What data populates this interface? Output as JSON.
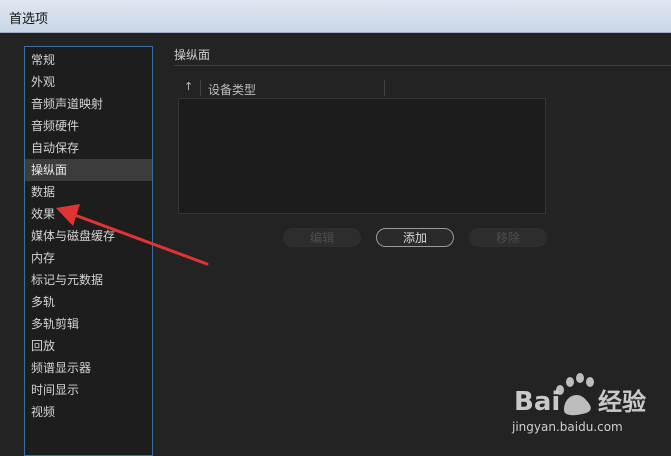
{
  "window": {
    "title": "首选项"
  },
  "sidebar": {
    "items": [
      {
        "label": "常规"
      },
      {
        "label": "外观"
      },
      {
        "label": "音频声道映射"
      },
      {
        "label": "音频硬件"
      },
      {
        "label": "自动保存"
      },
      {
        "label": "操纵面",
        "selected": true
      },
      {
        "label": "数据"
      },
      {
        "label": "效果"
      },
      {
        "label": "媒体与磁盘缓存"
      },
      {
        "label": "内存"
      },
      {
        "label": "标记与元数据"
      },
      {
        "label": "多轨"
      },
      {
        "label": "多轨剪辑"
      },
      {
        "label": "回放"
      },
      {
        "label": "频谱显示器"
      },
      {
        "label": "时间显示"
      },
      {
        "label": "视频"
      }
    ]
  },
  "panel": {
    "title": "操纵面",
    "table": {
      "sort_icon": "sort-up-icon",
      "columns": [
        "设备类型"
      ],
      "rows": []
    },
    "buttons": {
      "edit": "编辑",
      "add": "添加",
      "remove": "移除"
    }
  },
  "watermark": {
    "brand": "Bai经验",
    "url": "jingyan.baidu.com"
  },
  "colors": {
    "accent_border": "#3a6ea5",
    "annotation_arrow": "#e03434"
  }
}
